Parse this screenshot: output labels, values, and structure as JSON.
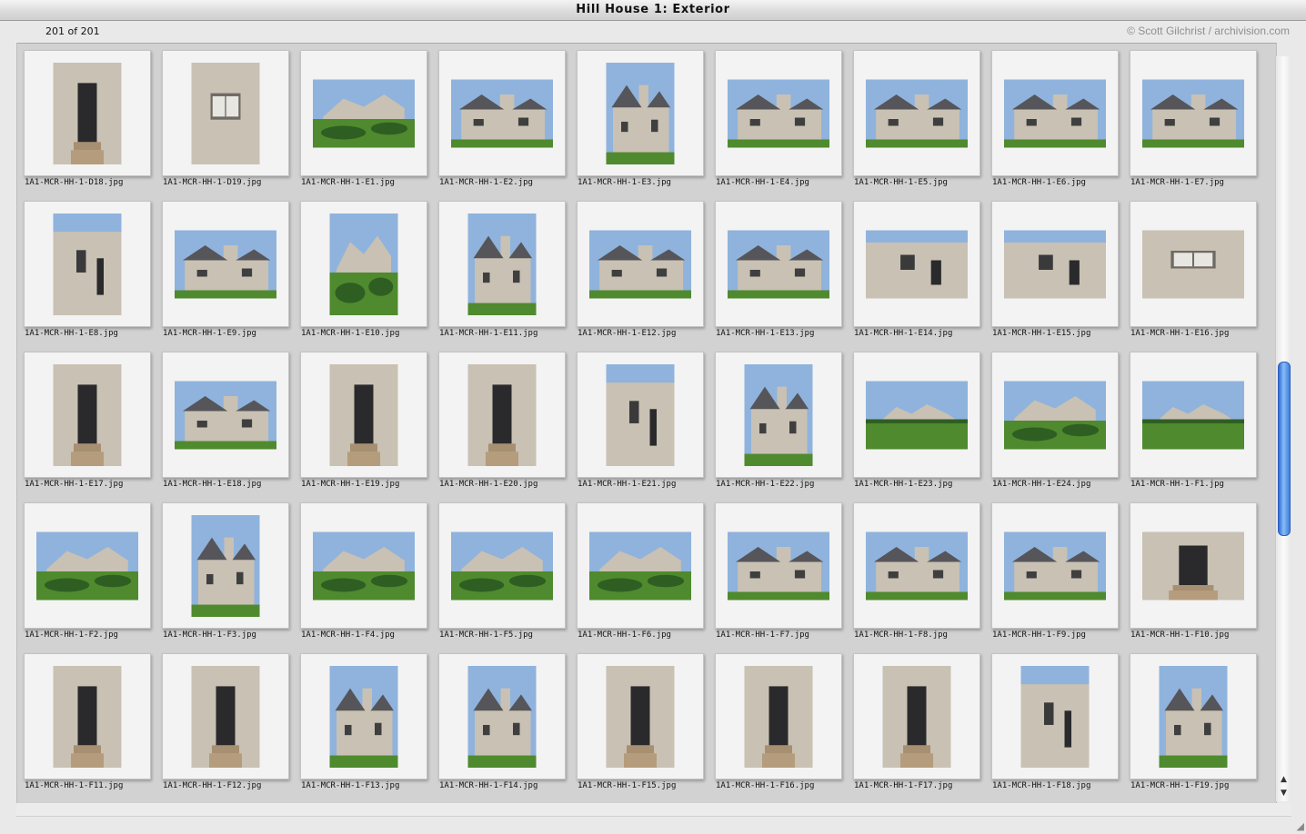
{
  "window": {
    "title": "Hill House 1: Exterior"
  },
  "header": {
    "count": "201 of 201",
    "copyright": "© Scott Gilchrist / archivision.com"
  },
  "thumbnails": [
    {
      "file": "1A1-MCR-HH-1-D18.jpg",
      "orient": "portrait",
      "tone": "door"
    },
    {
      "file": "1A1-MCR-HH-1-D19.jpg",
      "orient": "portrait",
      "tone": "window"
    },
    {
      "file": "1A1-MCR-HH-1-E1.jpg",
      "orient": "landscape",
      "tone": "garden"
    },
    {
      "file": "1A1-MCR-HH-1-E2.jpg",
      "orient": "landscape",
      "tone": "house"
    },
    {
      "file": "1A1-MCR-HH-1-E3.jpg",
      "orient": "portrait",
      "tone": "house"
    },
    {
      "file": "1A1-MCR-HH-1-E4.jpg",
      "orient": "landscape",
      "tone": "house"
    },
    {
      "file": "1A1-MCR-HH-1-E5.jpg",
      "orient": "landscape",
      "tone": "house"
    },
    {
      "file": "1A1-MCR-HH-1-E6.jpg",
      "orient": "landscape",
      "tone": "house"
    },
    {
      "file": "1A1-MCR-HH-1-E7.jpg",
      "orient": "landscape",
      "tone": "house"
    },
    {
      "file": "1A1-MCR-HH-1-E8.jpg",
      "orient": "portrait",
      "tone": "wall"
    },
    {
      "file": "1A1-MCR-HH-1-E9.jpg",
      "orient": "landscape",
      "tone": "house"
    },
    {
      "file": "1A1-MCR-HH-1-E10.jpg",
      "orient": "portrait",
      "tone": "garden"
    },
    {
      "file": "1A1-MCR-HH-1-E11.jpg",
      "orient": "portrait",
      "tone": "house"
    },
    {
      "file": "1A1-MCR-HH-1-E12.jpg",
      "orient": "landscape",
      "tone": "house"
    },
    {
      "file": "1A1-MCR-HH-1-E13.jpg",
      "orient": "landscape",
      "tone": "house"
    },
    {
      "file": "1A1-MCR-HH-1-E14.jpg",
      "orient": "landscape",
      "tone": "wall"
    },
    {
      "file": "1A1-MCR-HH-1-E15.jpg",
      "orient": "landscape",
      "tone": "wall"
    },
    {
      "file": "1A1-MCR-HH-1-E16.jpg",
      "orient": "landscape",
      "tone": "window"
    },
    {
      "file": "1A1-MCR-HH-1-E17.jpg",
      "orient": "portrait",
      "tone": "door"
    },
    {
      "file": "1A1-MCR-HH-1-E18.jpg",
      "orient": "landscape",
      "tone": "house"
    },
    {
      "file": "1A1-MCR-HH-1-E19.jpg",
      "orient": "portrait",
      "tone": "door"
    },
    {
      "file": "1A1-MCR-HH-1-E20.jpg",
      "orient": "portrait",
      "tone": "door"
    },
    {
      "file": "1A1-MCR-HH-1-E21.jpg",
      "orient": "portrait",
      "tone": "wall"
    },
    {
      "file": "1A1-MCR-HH-1-E22.jpg",
      "orient": "portrait",
      "tone": "house"
    },
    {
      "file": "1A1-MCR-HH-1-E23.jpg",
      "orient": "landscape",
      "tone": "lawn"
    },
    {
      "file": "1A1-MCR-HH-1-E24.jpg",
      "orient": "landscape",
      "tone": "garden"
    },
    {
      "file": "1A1-MCR-HH-1-F1.jpg",
      "orient": "landscape",
      "tone": "lawn"
    },
    {
      "file": "1A1-MCR-HH-1-F2.jpg",
      "orient": "landscape",
      "tone": "garden"
    },
    {
      "file": "1A1-MCR-HH-1-F3.jpg",
      "orient": "portrait",
      "tone": "house"
    },
    {
      "file": "1A1-MCR-HH-1-F4.jpg",
      "orient": "landscape",
      "tone": "garden"
    },
    {
      "file": "1A1-MCR-HH-1-F5.jpg",
      "orient": "landscape",
      "tone": "garden"
    },
    {
      "file": "1A1-MCR-HH-1-F6.jpg",
      "orient": "landscape",
      "tone": "garden"
    },
    {
      "file": "1A1-MCR-HH-1-F7.jpg",
      "orient": "landscape",
      "tone": "house"
    },
    {
      "file": "1A1-MCR-HH-1-F8.jpg",
      "orient": "landscape",
      "tone": "house"
    },
    {
      "file": "1A1-MCR-HH-1-F9.jpg",
      "orient": "landscape",
      "tone": "house"
    },
    {
      "file": "1A1-MCR-HH-1-F10.jpg",
      "orient": "landscape",
      "tone": "door"
    },
    {
      "file": "1A1-MCR-HH-1-F11.jpg",
      "orient": "portrait",
      "tone": "door"
    },
    {
      "file": "1A1-MCR-HH-1-F12.jpg",
      "orient": "portrait",
      "tone": "door"
    },
    {
      "file": "1A1-MCR-HH-1-F13.jpg",
      "orient": "portrait",
      "tone": "house"
    },
    {
      "file": "1A1-MCR-HH-1-F14.jpg",
      "orient": "portrait",
      "tone": "house"
    },
    {
      "file": "1A1-MCR-HH-1-F15.jpg",
      "orient": "portrait",
      "tone": "door"
    },
    {
      "file": "1A1-MCR-HH-1-F16.jpg",
      "orient": "portrait",
      "tone": "door"
    },
    {
      "file": "1A1-MCR-HH-1-F17.jpg",
      "orient": "portrait",
      "tone": "door"
    },
    {
      "file": "1A1-MCR-HH-1-F18.jpg",
      "orient": "portrait",
      "tone": "wall"
    },
    {
      "file": "1A1-MCR-HH-1-F19.jpg",
      "orient": "portrait",
      "tone": "house"
    }
  ],
  "colors": {
    "sky": "#8fb3dc",
    "stucco": "#c9c1b3",
    "roof": "#55555a",
    "grass": "#4f8a2e",
    "hedge": "#2f5e22",
    "door": "#2a2a2c",
    "accent": "#3b7fe0"
  }
}
